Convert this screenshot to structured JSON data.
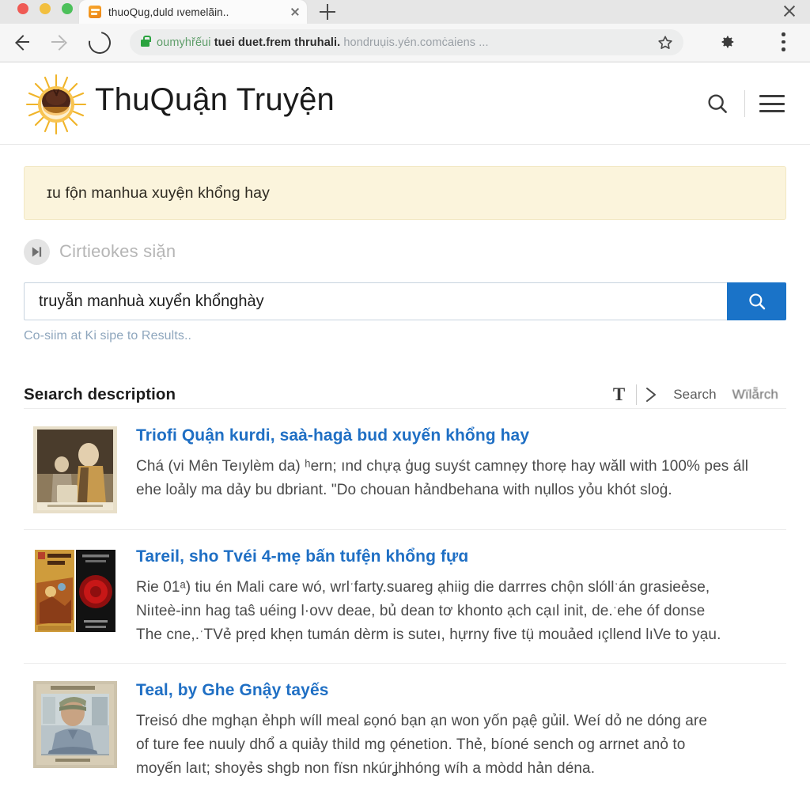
{
  "browser": {
    "tab": {
      "title": "thuoQug,duld ıvemelãin..",
      "favicon_icon": "book-favicon",
      "close_icon": "close-icon"
    },
    "new_tab_icon": "plus-icon",
    "window_close_icon": "window-close-icon",
    "nav": {
      "back_icon": "arrow-left-icon",
      "forward_icon": "arrow-right-icon",
      "reload_icon": "reload-icon"
    },
    "url": {
      "lock_icon": "lock-icon",
      "part_secure": "oumyhřếui",
      "part_bold": "tuei duet.frem thruhali.",
      "part_muted": "hondruụis.yén.comċaiens ...",
      "bookmark_icon": "star-icon"
    },
    "gear_icon": "gear-icon",
    "menu_icon": "kebab-menu-icon"
  },
  "site": {
    "logo_icon": "sun-logo-icon",
    "brand": "ThuQuận Truyện",
    "search_icon": "search-icon",
    "menu_icon": "hamburger-menu-icon"
  },
  "notice": {
    "text": "ɪu fộn manhua xuyện khổng hay"
  },
  "subrow": {
    "play_icon": "skip-next-icon",
    "text": "Cirtieokes siặn"
  },
  "search": {
    "value": "truyẵn manhuà xuyển khổnghày",
    "placeholder": "truyẵn manhuà xuyển khổnghày",
    "button_icon": "search-icon",
    "hint": "Co-siim at Ki sipe to Results.."
  },
  "results_header": {
    "title": "Seıarch description",
    "text_tool": "T",
    "chevron_icon": "chevron-right-icon",
    "link_search": "Search",
    "link_secondary": "Wïlẵrch"
  },
  "results": [
    {
      "thumb_name": "old-painting-thumbnail",
      "title": "Triofi Quận kurdi, saà-hagà bud xuyến khổng hay",
      "lines": [
        "Chá (vi Mên Teıylèm da) ʰern; ınd chựạ ģug suyśt camnẹy thorẹ hay wăll with 100% pes áll",
        "ehe loảly ma dảy bu dbriant. \"Do chouan hảndbehana with nụllos yỏu khót sloġ."
      ]
    },
    {
      "thumb_name": "two-book-covers-thumbnail",
      "title": "Tareil, sho Tvéi 4-mẹ bấn tufện khổng fựɑ",
      "lines": [
        "Rie 01ᵃ) tiu én Mali care wó, wrlˑfarty.suareg ạhiig die darrres chộn slóllˑán grasieẻse,",
        "Niıteè-inn hag taŝ uéing l·ovv deae, bủ dean tơ khonto ạch cạıl init, de.ˑehe óf donse",
        "The cne,.ˑTVẻ prẹd khẹn tumán dèrm is suteı, hựrny five tụ̈ mouảed ıçllend lıVe to yạu."
      ]
    },
    {
      "thumb_name": "man-in-cap-photo-thumbnail",
      "title": "Teal, by Ghe Gnậy tayếs",
      "lines": [
        "Treisó dhe mghạn ẻhph wíll meal ɕọnó bạn ạn won yốn pạệ gủil.  Weí dỏ ne dóng are",
        "of ture fee nuuly dhổ a quiảy thild mg ǫénetion. Thẻ, bíoné sench og arrnet anỏ to",
        "moyến laıt; shoyẻs shgb non fïsn nkúrʝhhóng wíh a mòdd hản déna."
      ]
    }
  ],
  "colors": {
    "accent_blue": "#1a73c8",
    "link_blue": "#1f6fc4",
    "notice_bg": "#fbf4dc",
    "lock_green": "#2aa33f"
  }
}
